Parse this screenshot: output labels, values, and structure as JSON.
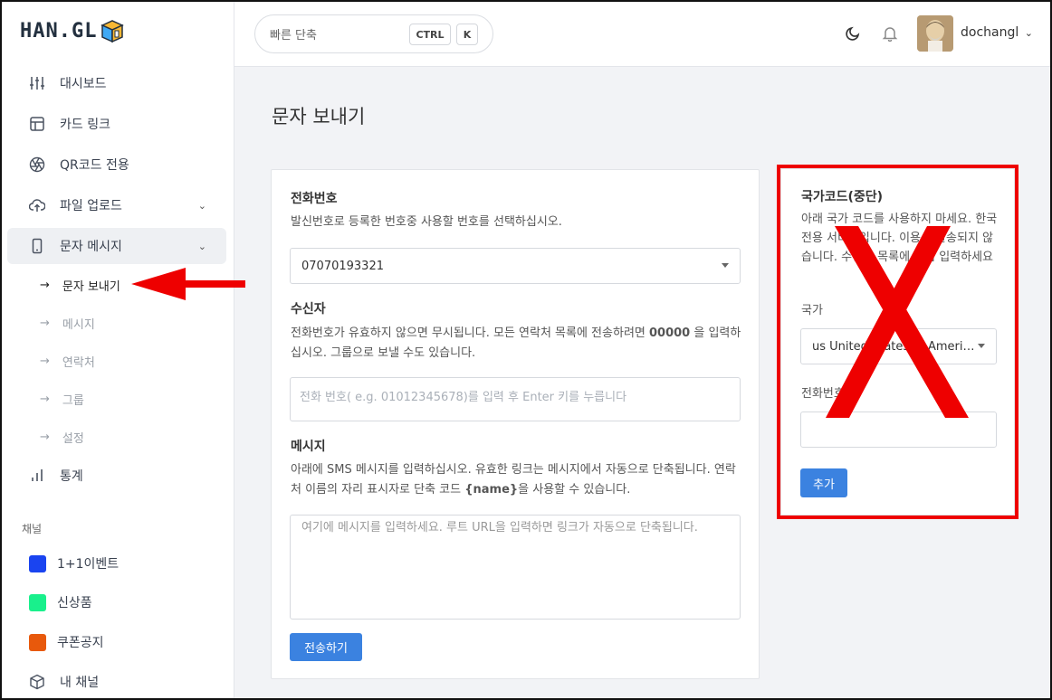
{
  "brand": {
    "logo_text": "HAN.GL",
    "accent": "#3b82e0",
    "annotation_color": "#ee0000"
  },
  "sidebar": {
    "items": [
      {
        "label": "대시보드",
        "icon": "sliders-icon"
      },
      {
        "label": "카드 링크",
        "icon": "layout-icon"
      },
      {
        "label": "QR코드 전용",
        "icon": "aperture-icon"
      },
      {
        "label": "파일 업로드",
        "icon": "upload-cloud-icon"
      },
      {
        "label": "문자 메시지",
        "icon": "smartphone-icon"
      }
    ],
    "sms_sub": [
      {
        "label": "문자 보내기"
      },
      {
        "label": "메시지"
      },
      {
        "label": "연락처"
      },
      {
        "label": "그룹"
      },
      {
        "label": "설정"
      }
    ],
    "stats": {
      "label": "통계",
      "icon": "bar-chart-icon"
    },
    "channels_label": "채널",
    "channels": [
      {
        "label": "1+1이벤트",
        "color": "#1a44f0"
      },
      {
        "label": "신상품",
        "color": "#19f08c"
      },
      {
        "label": "쿠폰공지",
        "color": "#e8590c"
      }
    ],
    "my_channel": {
      "label": "내 채널",
      "icon": "box-icon"
    }
  },
  "topbar": {
    "search_placeholder": "빠른 단축",
    "kbd_ctrl": "CTRL",
    "kbd_k": "K",
    "username": "dochangl"
  },
  "main": {
    "title": "문자 보내기",
    "phone": {
      "label": "전화번호",
      "help": "발신번호로 등록한 번호중 사용할 번호를 선택하십시오.",
      "selected": "07070193321"
    },
    "recipient": {
      "label": "수신자",
      "help_1": "전화번호가 유효하지 않으면 무시됩니다. 모든 연락처 목록에 전송하려면",
      "help_bold": "00000",
      "help_2": "을 입력하십시오. 그룹으로 보낼 수도 있습니다.",
      "placeholder": "전화 번호( e.g. 01012345678)를 입력 후 Enter 키를 누릅니다"
    },
    "message": {
      "label": "메시지",
      "help_1": "아래에 SMS 메시지를 입력하십시오. 유효한 링크는 메시지에서 자동으로 단축됩니다. 연락처 이름의 자리 표시자로 단축 코드",
      "help_bold": "{name}",
      "help_2": "을 사용할 수 있습니다.",
      "placeholder": "여기에 메시지를 입력하세요. 루트 URL을 입력하면 링크가 자동으로 단축됩니다."
    },
    "send_button": "전송하기"
  },
  "country_panel": {
    "label": "국가코드(중단)",
    "help": "아래 국가 코드를 사용하지 마세요. 한국전용 서비스입니다. 이용시 발송되지 않습니다. 수신자 목록에 직접 입력하세요",
    "country_label": "국가",
    "country_selected": "us United States of America",
    "phone_label": "전화번호",
    "add_button": "추가"
  }
}
